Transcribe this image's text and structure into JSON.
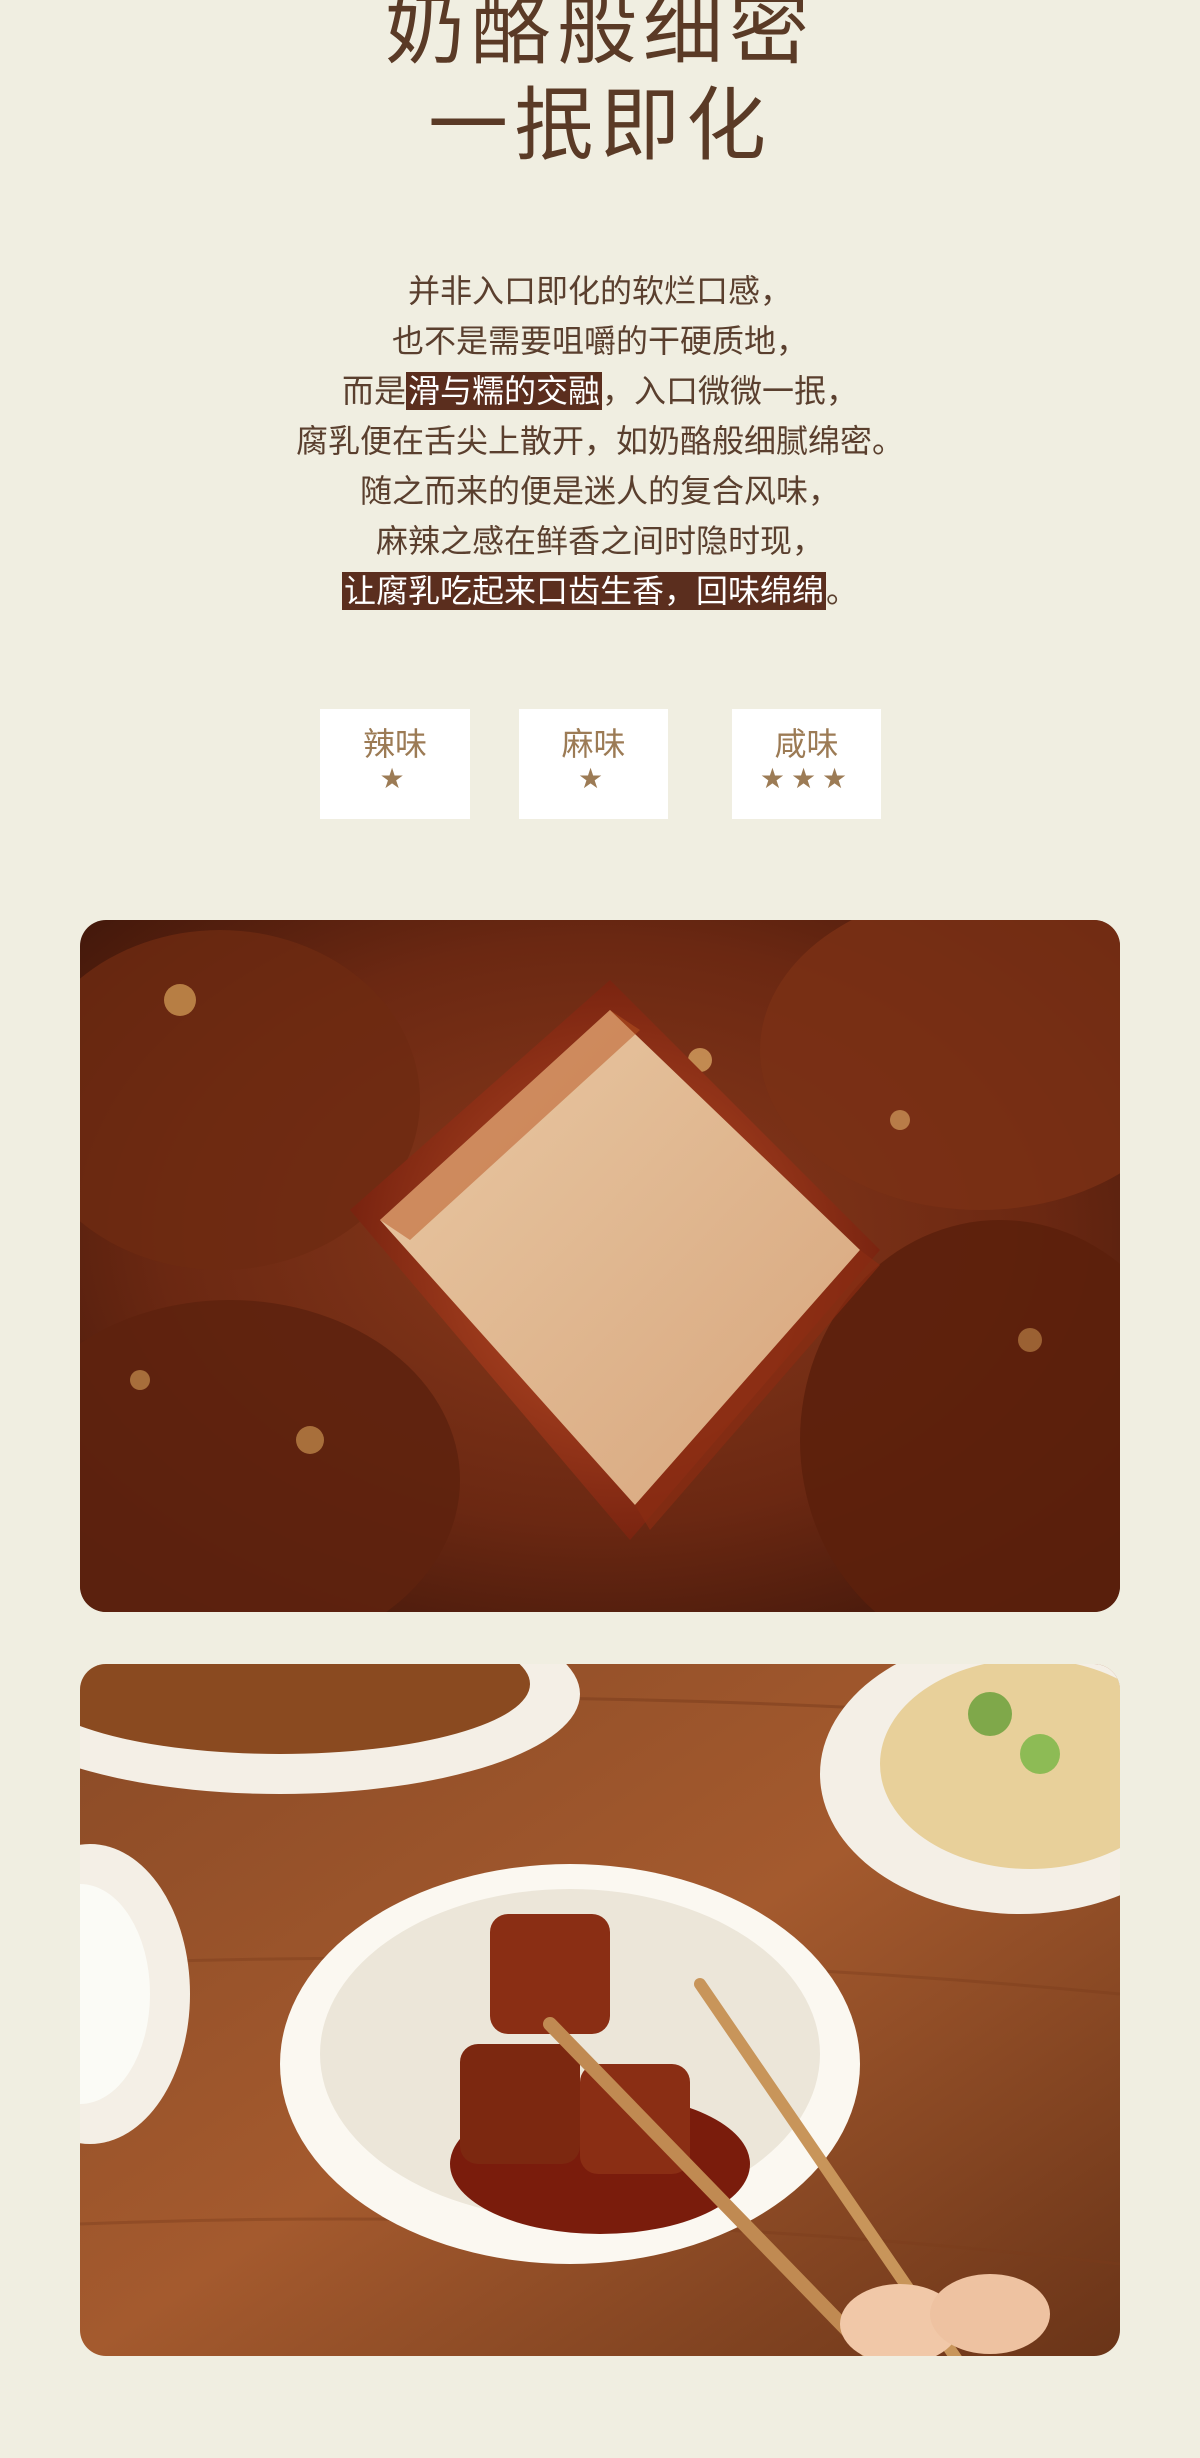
{
  "headline": {
    "line1": "奶酪般细密",
    "line2": "一抿即化"
  },
  "description": {
    "line1": "并非入口即化的软烂口感，",
    "line2": "也不是需要咀嚼的干硬质地，",
    "line3_before": "而是",
    "line3_highlight": "滑与糯的交融",
    "line3_after": "，入口微微一抿，",
    "line4": "腐乳便在舌尖上散开，如奶酪般细腻绵密。",
    "line5": "随之而来的便是迷人的复合风味，",
    "line6": "麻辣之感在鲜香之间时隐时现，",
    "line7_highlight": "让腐乳吃起来口齿生香，回味绵绵",
    "line7_after": "。"
  },
  "ratings": [
    {
      "label": "辣味",
      "stars": "★",
      "stars_count": 1
    },
    {
      "label": "麻味",
      "stars": "★",
      "stars_count": 1
    },
    {
      "label": "咸味",
      "stars": "★★★",
      "stars_count": 3
    }
  ],
  "colors": {
    "background": "#f0eee1",
    "headline": "#5a3a26",
    "highlight_bg": "#5b2e1e",
    "rating_text": "#9c7b55"
  }
}
